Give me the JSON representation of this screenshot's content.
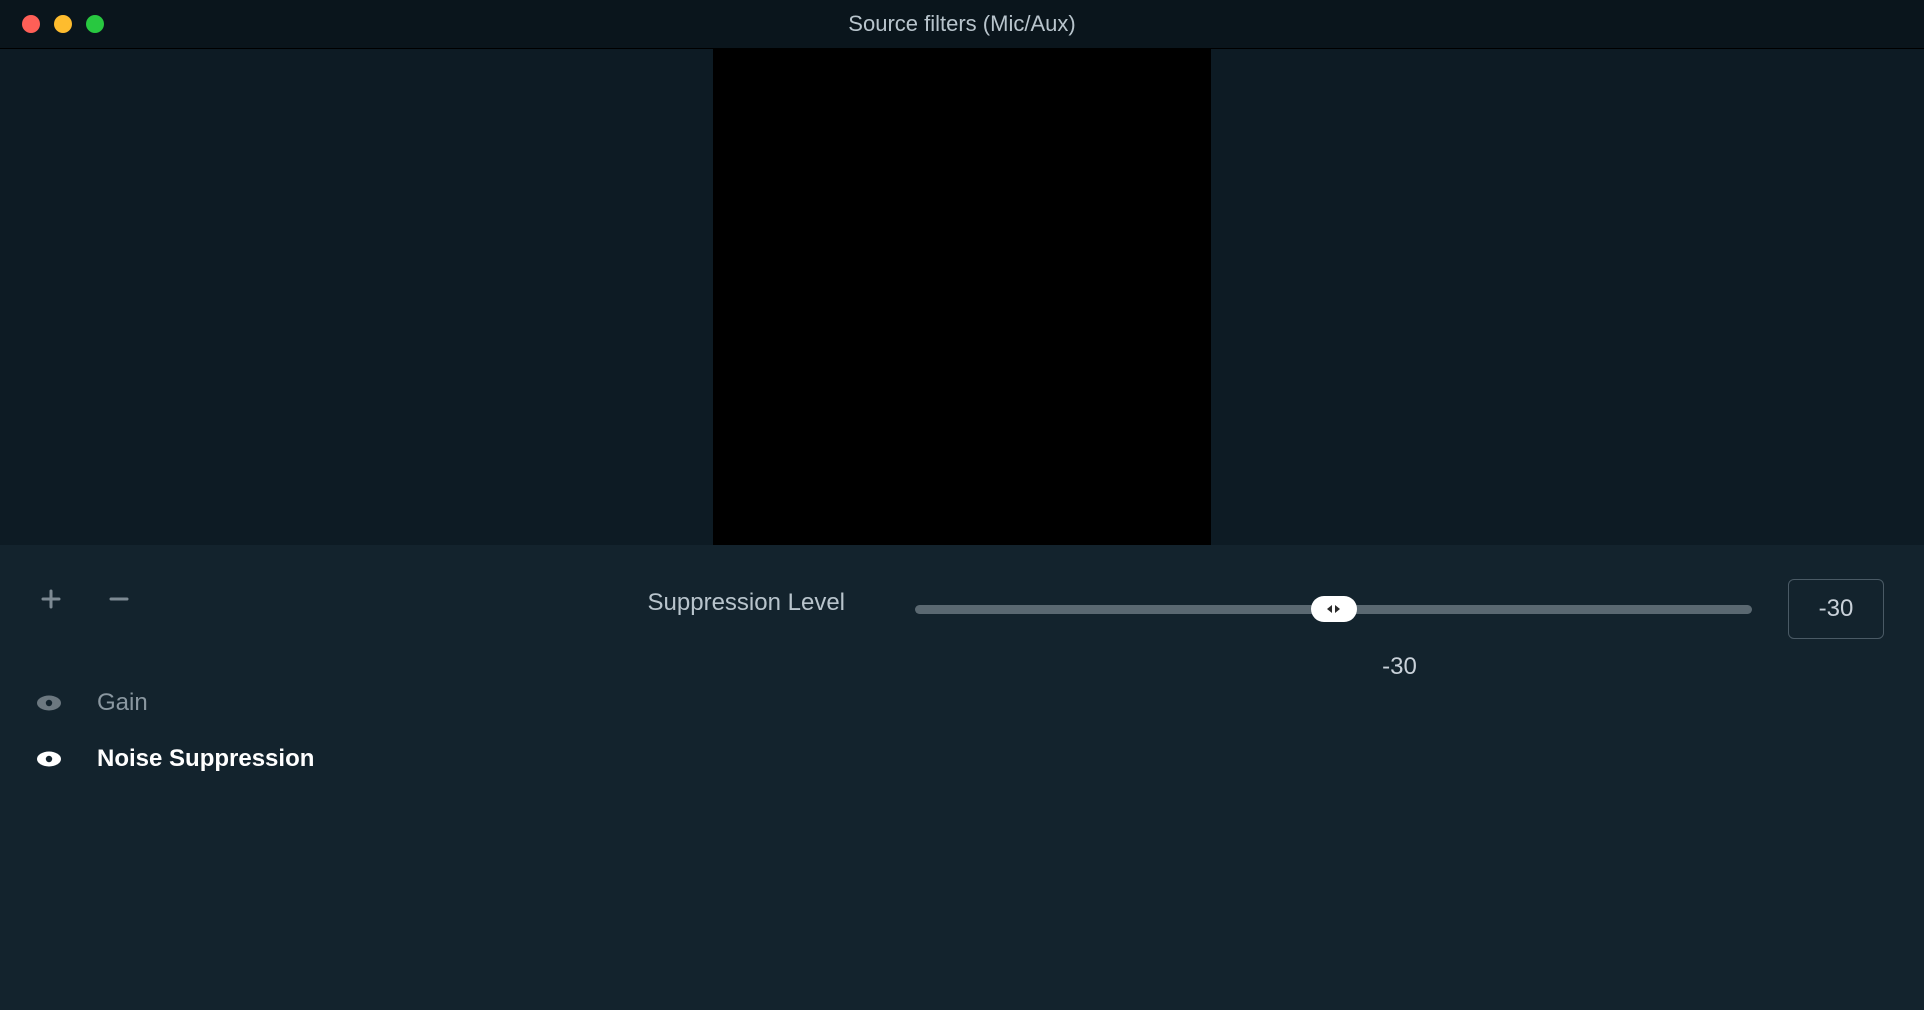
{
  "window": {
    "title": "Source filters (Mic/Aux)"
  },
  "sidebar": {
    "filters": [
      {
        "label": "Gain",
        "active": false
      },
      {
        "label": "Noise Suppression",
        "active": true
      }
    ]
  },
  "settings": {
    "suppression": {
      "label": "Suppression Level",
      "value": -30,
      "display": "-30",
      "input": "-30",
      "min": -60,
      "max": 0
    }
  }
}
